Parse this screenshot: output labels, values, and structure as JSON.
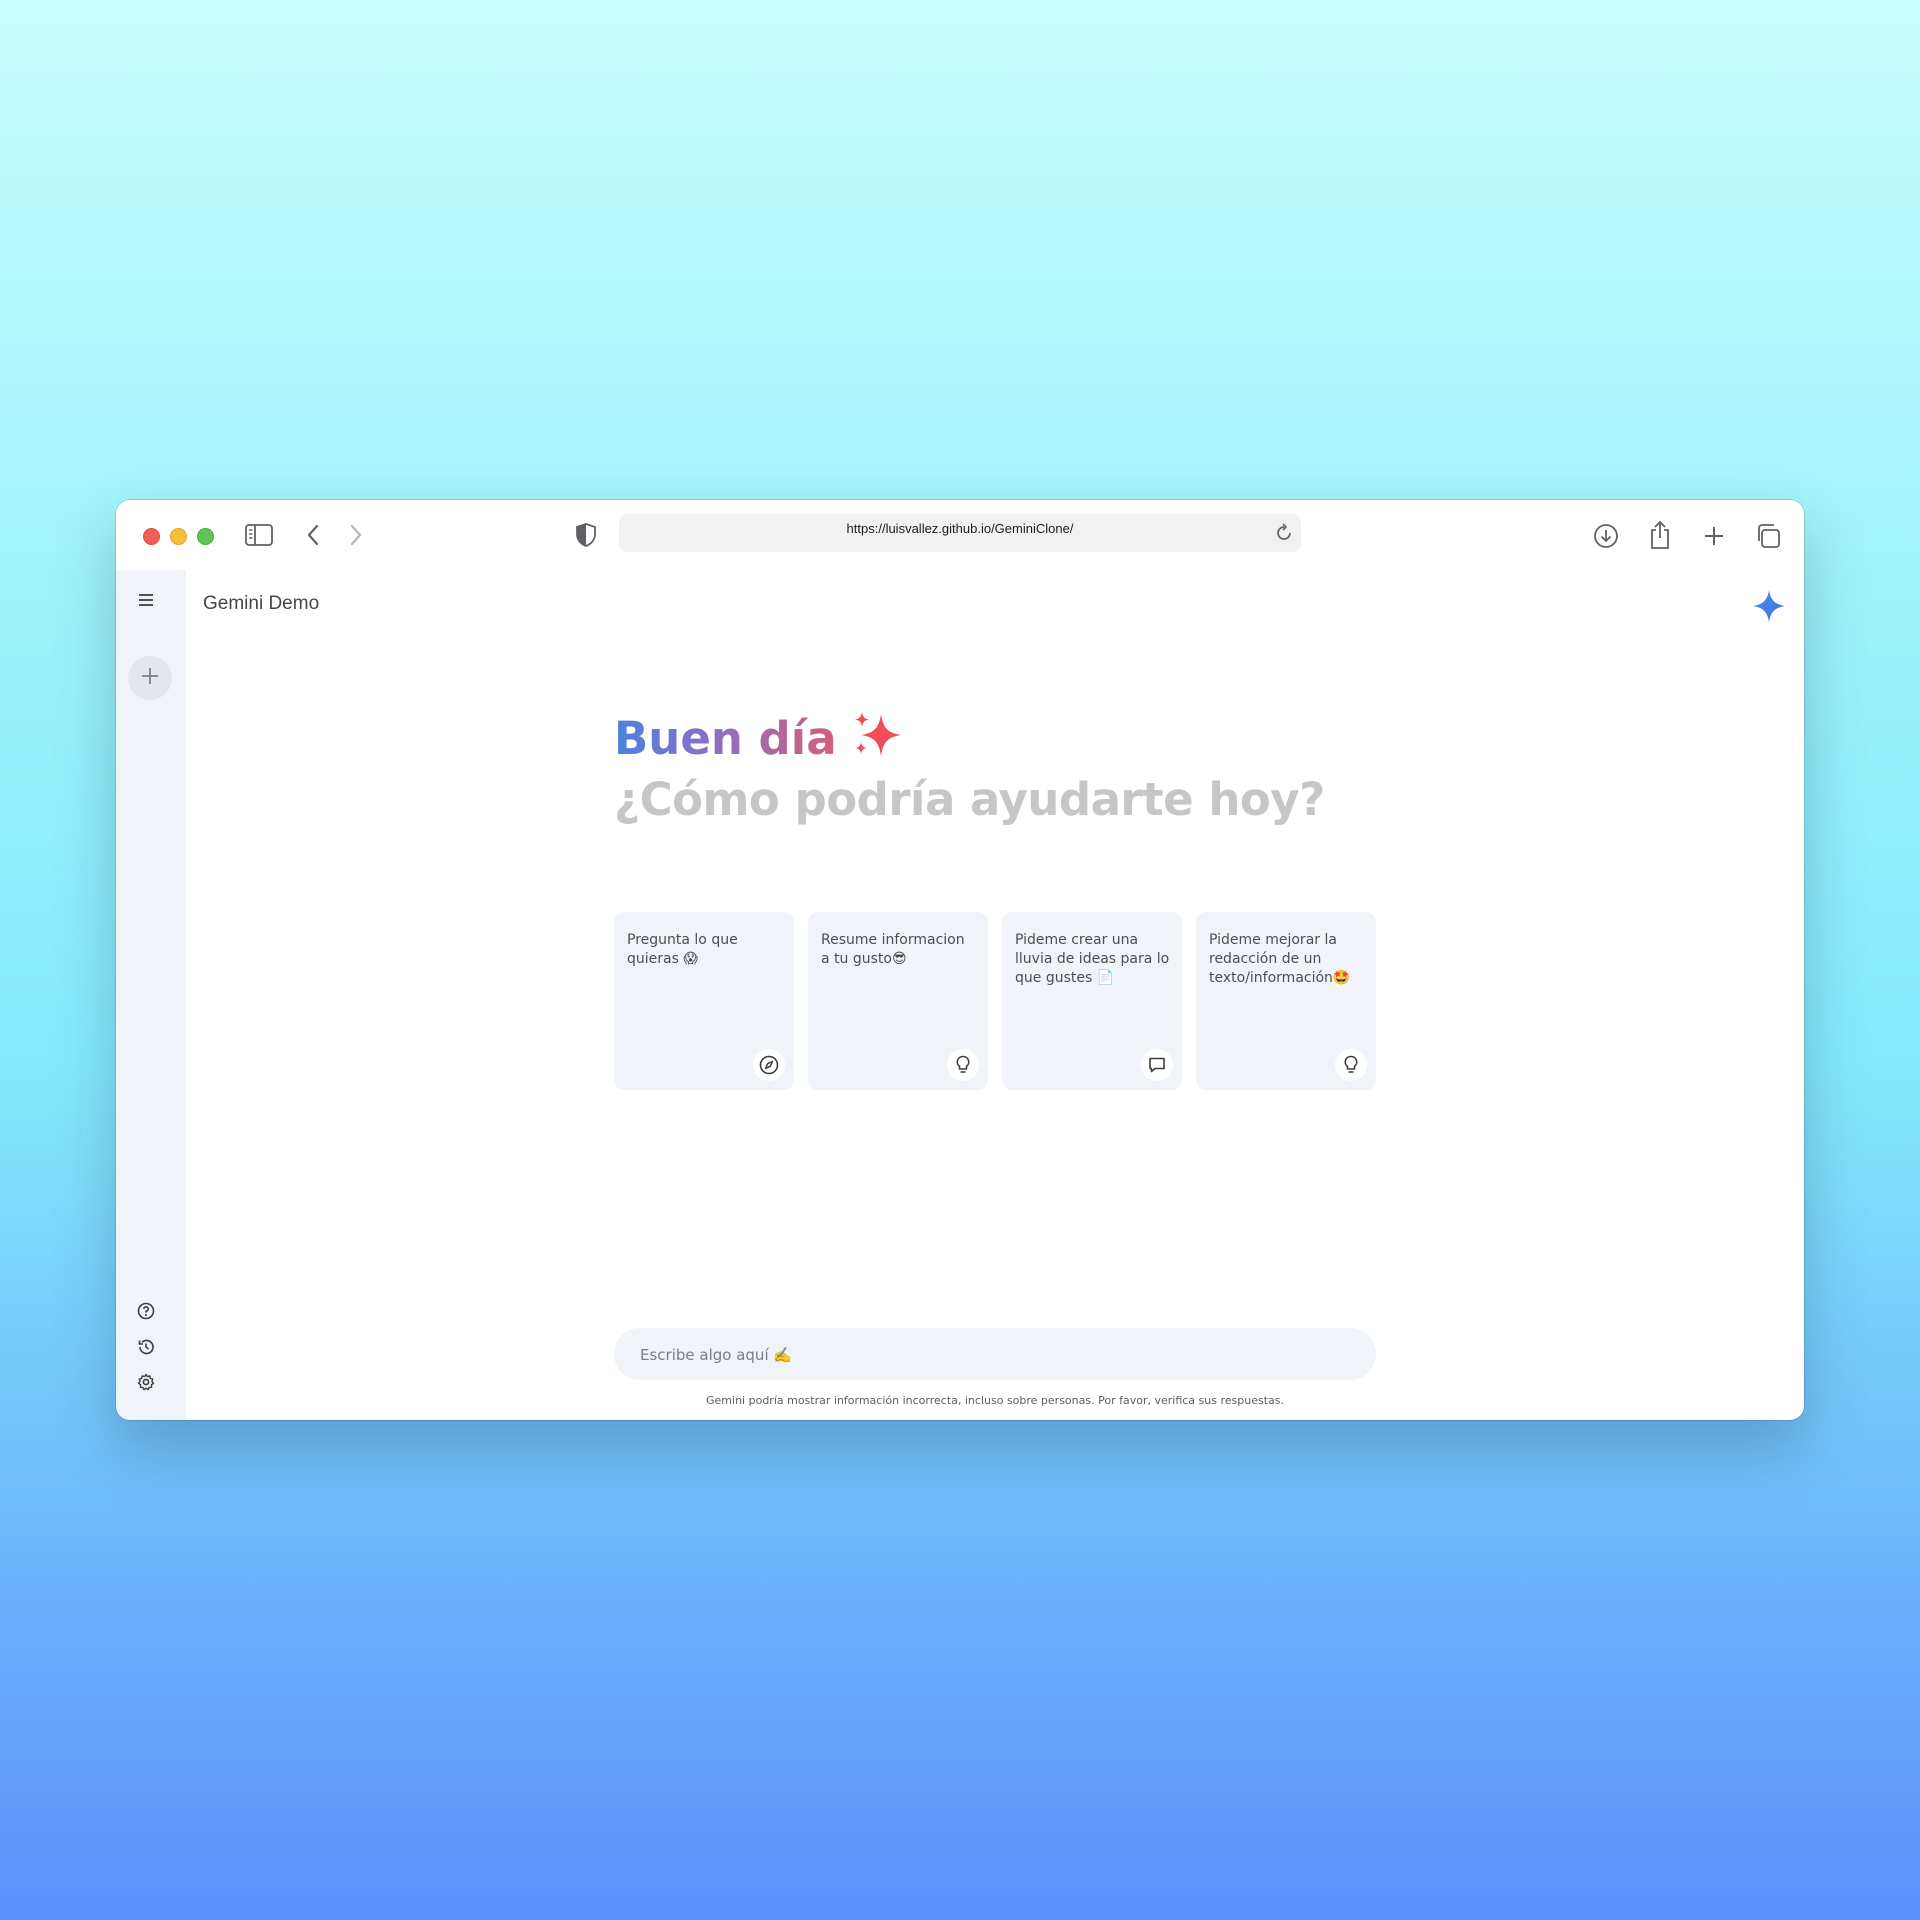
{
  "browser": {
    "url": "https://luisvallez.github.io/GeminiClone/"
  },
  "app": {
    "title": "Gemini Demo"
  },
  "greeting": {
    "title": "Buen día",
    "title_emoji": "sparkles-icon",
    "subtitle": "¿Cómo podría ayudarte hoy?"
  },
  "cards": [
    {
      "text": "Pregunta lo que quieras 😱",
      "icon": "compass-icon"
    },
    {
      "text": "Resume informacion a tu gusto😎",
      "icon": "lightbulb-icon"
    },
    {
      "text": "Pideme crear una lluvia de ideas para lo que gustes 📄",
      "icon": "chat-icon"
    },
    {
      "text": "Pideme mejorar la redacción de un texto/información🤩",
      "icon": "lightbulb-icon"
    }
  ],
  "input": {
    "placeholder": "Escribe algo aquí ✍️"
  },
  "disclaimer": "Gemini podría mostrar información incorrecta, incluso sobre personas. Por favor, verifica sus respuestas.",
  "colors": {
    "accent_blue": "#4b82e0",
    "accent_pink": "#d36078",
    "sidebar_bg": "#f0f4f9",
    "card_bg": "#f0f4f9",
    "subtitle_gray": "#c6c6c6"
  }
}
